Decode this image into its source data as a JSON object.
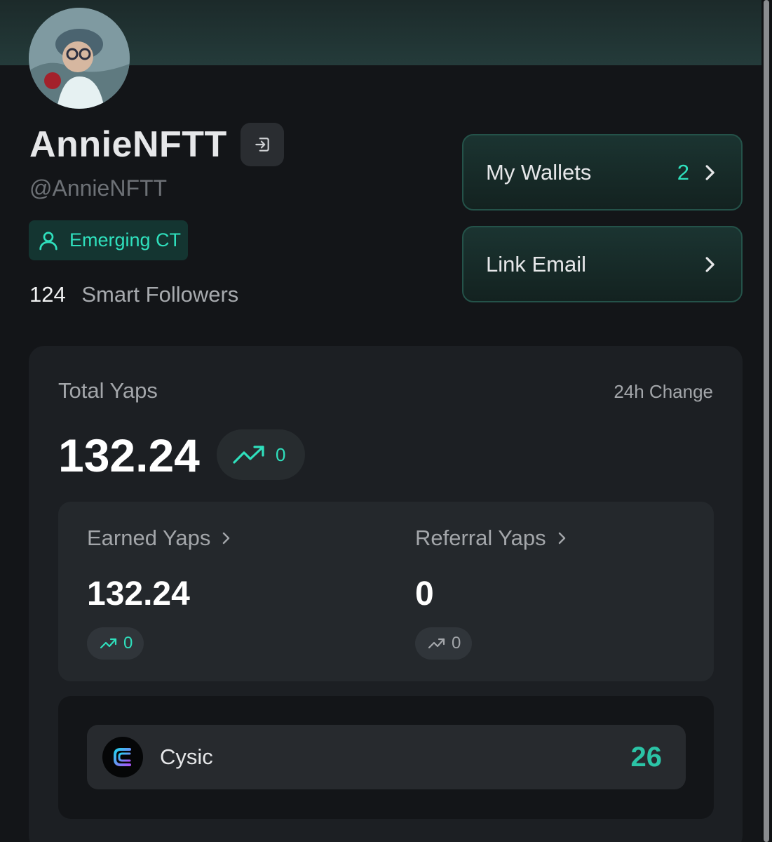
{
  "profile": {
    "display_name": "AnnieNFTT",
    "handle": "@AnnieNFTT",
    "badge": "Emerging CT",
    "smart_followers_count": "124",
    "smart_followers_label": "Smart Followers"
  },
  "links": {
    "wallets_label": "My Wallets",
    "wallets_count": "2",
    "email_label": "Link Email"
  },
  "yaps": {
    "total_label": "Total Yaps",
    "change_label": "24h Change",
    "total_value": "132.24",
    "total_change": "0",
    "earned_label": "Earned Yaps",
    "earned_value": "132.24",
    "earned_change": "0",
    "referral_label": "Referral Yaps",
    "referral_value": "0",
    "referral_change": "0"
  },
  "projects": [
    {
      "name": "Cysic",
      "score": "26",
      "icon": "cysic-logo-icon"
    }
  ],
  "colors": {
    "accent": "#2fe0bd",
    "background": "#131518",
    "panel": "#1c1f23",
    "banner": "#243b3a"
  }
}
